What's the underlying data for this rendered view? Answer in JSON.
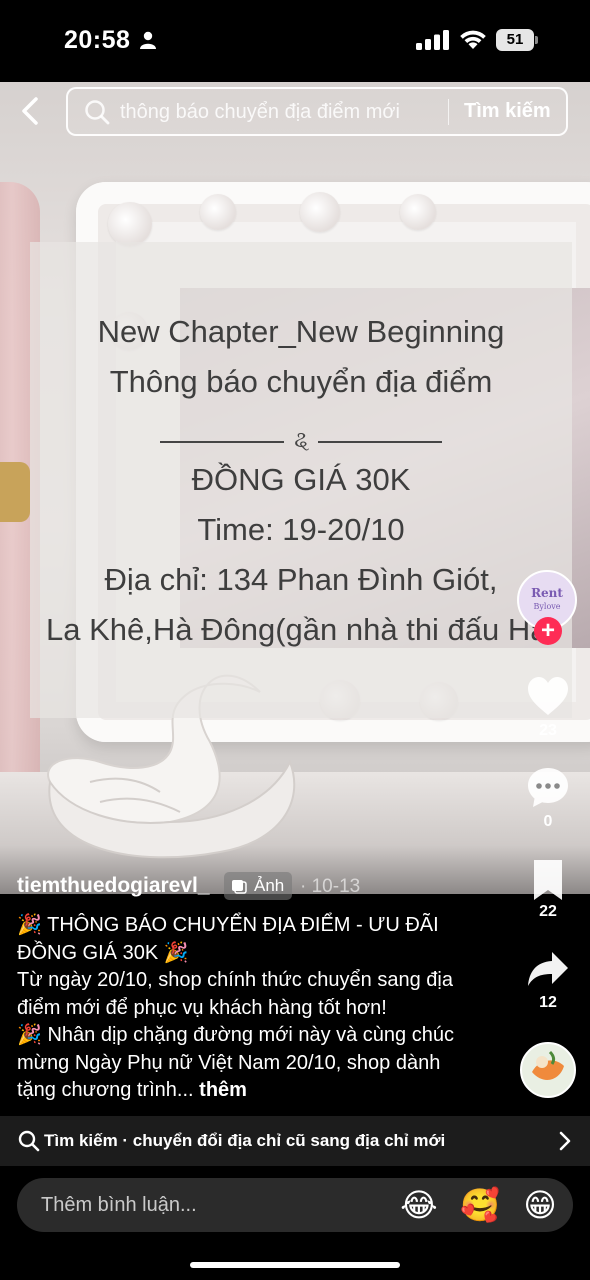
{
  "status_bar": {
    "time": "20:58",
    "battery": "51"
  },
  "search": {
    "query": "thông báo chuyển địa điểm mới",
    "button": "Tìm kiếm"
  },
  "post_image": {
    "lines": [
      "New Chapter_New Beginning",
      "Thông báo chuyển địa điểm",
      "ĐỒNG GIÁ 30K",
      "Time: 19-20/10",
      "Địa chỉ: 134 Phan Đình Giót,",
      "La Khê,Hà Đông(gần nhà thi đấu Hà"
    ],
    "ornament": "ୡ"
  },
  "creator": {
    "avatar_line1": "Rent",
    "avatar_line2": "Bylove",
    "follow": "+"
  },
  "actions": {
    "likes": "23",
    "comments": "0",
    "saves": "22",
    "shares": "12"
  },
  "caption": {
    "username": "tiemthuedogiarevl_",
    "badge": "Ảnh",
    "date": "· 10-13",
    "lines": [
      "🎉 THÔNG BÁO CHUYỂN ĐỊA ĐIỂM - ƯU ĐÃI ĐỒNG GIÁ 30K 🎉",
      "Từ ngày 20/10, shop chính thức chuyển sang địa điểm mới để phục vụ khách hàng tốt hơn!",
      "🎉 Nhân dịp chặng đường mới này và cùng chúc mừng Ngày Phụ nữ Việt Nam 20/10, shop dành tặng chương trình..."
    ],
    "more": "thêm"
  },
  "related": {
    "text": "Tìm kiếm · chuyển đổi địa chỉ cũ sang địa chỉ mới"
  },
  "comment": {
    "placeholder": "Thêm bình luận...",
    "emojis": [
      "😂",
      "🥰",
      "😁"
    ]
  }
}
